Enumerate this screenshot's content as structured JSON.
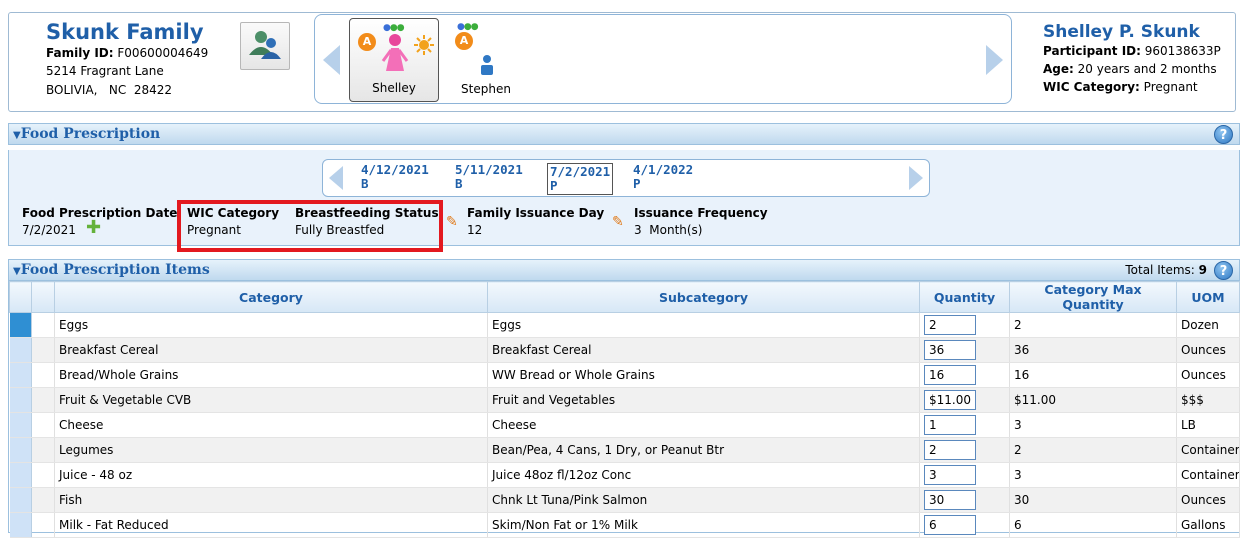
{
  "family": {
    "name": "Skunk Family",
    "id_label": "Family ID:",
    "id_value": "F00600004649",
    "address_line1": "5214 Fragrant Lane",
    "address_line2": "BOLIVIA,   NC  28422",
    "icon": "family-group-icon"
  },
  "members": [
    {
      "name": "Shelley",
      "selected": true,
      "alert": "A",
      "icon": "pregnant-woman-icon",
      "status_dots": [
        "#3a6fd8",
        "#3cae3c",
        "#3cae3c"
      ]
    },
    {
      "name": "Stephen",
      "selected": false,
      "alert": "A",
      "icon": "infant-icon",
      "status_dots": [
        "#3a6fd8",
        "#3cae3c",
        "#3cae3c"
      ]
    }
  ],
  "participant": {
    "name": "Shelley P. Skunk",
    "id_label": "Participant ID:",
    "id_value": "960138633P",
    "age_label": "Age:",
    "age_value": "20 years and 2 months",
    "category_label": "WIC Category:",
    "category_value": "Pregnant"
  },
  "food_prescription": {
    "title": "Food Prescription",
    "dates": [
      {
        "date": "4/12/2021",
        "code": "B",
        "selected": false
      },
      {
        "date": "5/11/2021",
        "code": "B",
        "selected": false
      },
      {
        "date": "7/2/2021",
        "code": "P",
        "selected": true
      },
      {
        "date": "4/1/2022",
        "code": "P",
        "selected": false
      }
    ],
    "prescription_date_label": "Food Prescription Date",
    "prescription_date_value": "7/2/2021",
    "wic_category_label": "WIC Category",
    "wic_category_value": "Pregnant",
    "breastfeeding_label": "Breastfeeding Status",
    "breastfeeding_value": "Fully Breastfed",
    "issuance_day_label": "Family Issuance Day",
    "issuance_day_value": "12",
    "issuance_freq_label": "Issuance Frequency",
    "issuance_freq_value": "3  Month(s)",
    "highlight_color": "#e3191f"
  },
  "items": {
    "title": "Food Prescription Items",
    "total_label": "Total Items:",
    "total_value": "9",
    "columns": [
      "Category",
      "Subcategory",
      "Quantity",
      "Category Max Quantity",
      "UOM"
    ],
    "rows": [
      {
        "category": "Eggs",
        "subcategory": "Eggs",
        "quantity": "2",
        "max": "2",
        "uom": "Dozen"
      },
      {
        "category": "Breakfast Cereal",
        "subcategory": "Breakfast Cereal",
        "quantity": "36",
        "max": "36",
        "uom": "Ounces"
      },
      {
        "category": "Bread/Whole Grains",
        "subcategory": "WW Bread or Whole Grains",
        "quantity": "16",
        "max": "16",
        "uom": "Ounces"
      },
      {
        "category": "Fruit & Vegetable CVB",
        "subcategory": "Fruit and Vegetables",
        "quantity": "$11.00",
        "max": "$11.00",
        "uom": "$$$"
      },
      {
        "category": "Cheese",
        "subcategory": "Cheese",
        "quantity": "1",
        "max": "3",
        "uom": "LB"
      },
      {
        "category": "Legumes",
        "subcategory": "Bean/Pea, 4 Cans, 1 Dry, or Peanut Btr",
        "quantity": "2",
        "max": "2",
        "uom": "Containers"
      },
      {
        "category": "Juice - 48 oz",
        "subcategory": "Juice 48oz fl/12oz Conc",
        "quantity": "3",
        "max": "3",
        "uom": "Containers"
      },
      {
        "category": "Fish",
        "subcategory": "Chnk Lt Tuna/Pink Salmon",
        "quantity": "30",
        "max": "30",
        "uom": "Ounces"
      },
      {
        "category": "Milk - Fat Reduced",
        "subcategory": "Skim/Non Fat or 1% Milk",
        "quantity": "6",
        "max": "6",
        "uom": "Gallons"
      }
    ]
  },
  "colors": {
    "title_blue": "#1f5fa8",
    "header_gradient_top": "#e6f2fb",
    "header_gradient_bottom": "#bfd9ee",
    "selected_row_marker": "#2f8fd3",
    "alert_orange": "#f28c1a"
  }
}
